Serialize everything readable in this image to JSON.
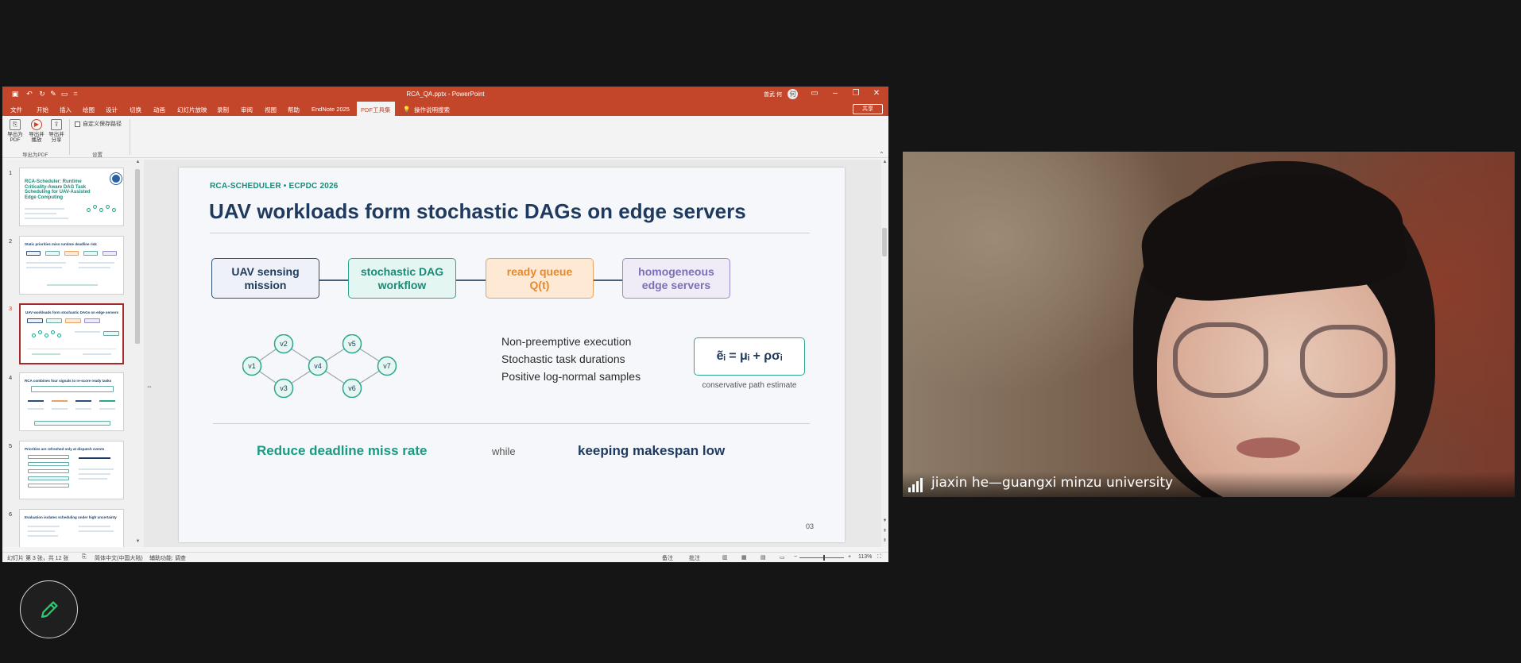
{
  "window": {
    "title": "RCA_QA.pptx - PowerPoint",
    "user": "曾武 何",
    "user_initial": "何",
    "qat_more": "="
  },
  "menu": {
    "tabs": [
      "文件",
      "开始",
      "插入",
      "绘图",
      "设计",
      "切换",
      "动画",
      "幻灯片放映",
      "录制",
      "审阅",
      "视图",
      "帮助",
      "EndNote 2025",
      "PDF工具集"
    ],
    "search_label": "操作说明搜索",
    "share_label": "共享"
  },
  "ribbon": {
    "btn_export_pdf": "导出为PDF",
    "btn_export_open": "导出并播放",
    "btn_export_share": "导出并分享",
    "checkbox_label": "自定义保存路径",
    "group_export": "导出为PDF",
    "group_settings": "设置"
  },
  "thumbnails": {
    "numbers": [
      "1",
      "2",
      "3",
      "4",
      "5",
      "6"
    ],
    "t1_title": "RCA-Scheduler: Runtime Criticality-Aware DAG Task Scheduling for UAV-Assisted Edge Computing",
    "t2_title": "Static priorities miss runtime deadline risk",
    "t3_title": "UAV workloads form stochastic DAGs on edge servers",
    "t4_title": "RCA combines four signals to re-score ready tasks",
    "t5_title": "Priorities are refreshed only at dispatch events",
    "t6_title": "Evaluation isolates scheduling under high uncertainty"
  },
  "slide": {
    "tag": "RCA-SCHEDULER • ECPDC 2026",
    "title": "UAV workloads form stochastic DAGs on edge servers",
    "flow": [
      "UAV sensing\nmission",
      "stochastic DAG\nworkflow",
      "ready queue\nQ(t)",
      "homogeneous\nedge servers"
    ],
    "dag_nodes": [
      "v1",
      "v2",
      "v3",
      "v4",
      "v5",
      "v6",
      "v7"
    ],
    "bullets": [
      "Non-preemptive execution",
      "Stochastic task durations",
      "Positive log-normal samples"
    ],
    "formula": "ẽᵢ = μᵢ + ρσᵢ",
    "formula_caption": "conservative path estimate",
    "goal_left": "Reduce deadline miss rate",
    "goal_connector": "while",
    "goal_right": "keeping makespan low",
    "page_number": "03"
  },
  "status": {
    "slide_info": "幻灯片 第 3 张，共 12 张",
    "language": "简体中文(中国大陆)",
    "accessibility": "辅助功能: 调查",
    "notes": "备注",
    "comments": "批注",
    "zoom": "113%"
  },
  "video": {
    "participant_name": "jiaxin he—guangxi minzu university"
  },
  "colors": {
    "ppt_accent": "#c4462a",
    "teal": "#1a8a78",
    "navy": "#1f3a5f"
  }
}
